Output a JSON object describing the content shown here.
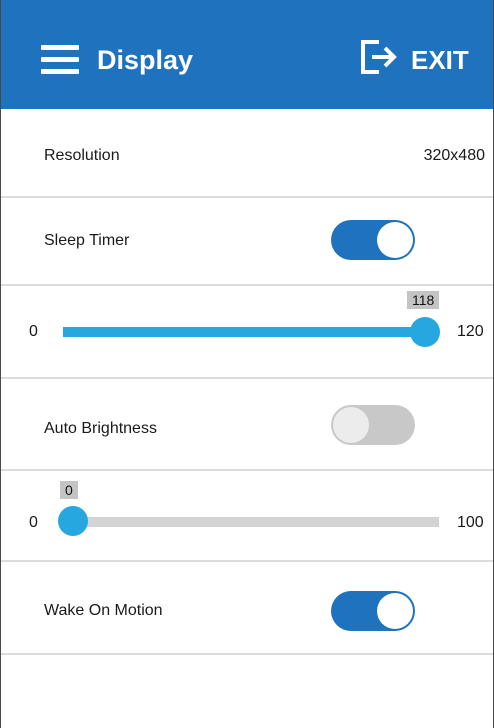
{
  "header": {
    "title": "Display",
    "exit_label": "EXIT",
    "background_color": "#1e72be"
  },
  "rows": {
    "resolution": {
      "label": "Resolution",
      "value": "320x480"
    },
    "sleep_timer": {
      "label": "Sleep Timer",
      "enabled": true
    },
    "sleep_slider": {
      "min": "0",
      "max": "120",
      "value": "118"
    },
    "auto_brightness": {
      "label": "Auto Brightness",
      "enabled": false
    },
    "brightness_slider": {
      "min": "0",
      "max": "100",
      "value": "0"
    },
    "wake_on_motion": {
      "label": "Wake On Motion",
      "enabled": true
    }
  },
  "colors": {
    "toggle_on": "#1e72be",
    "toggle_off": "#c8c8c8",
    "slider_accent": "#27a7e0",
    "slider_track": "#d3d3d3"
  },
  "icons": {
    "menu": "hamburger-menu-icon",
    "exit": "exit-door-arrow-icon"
  }
}
